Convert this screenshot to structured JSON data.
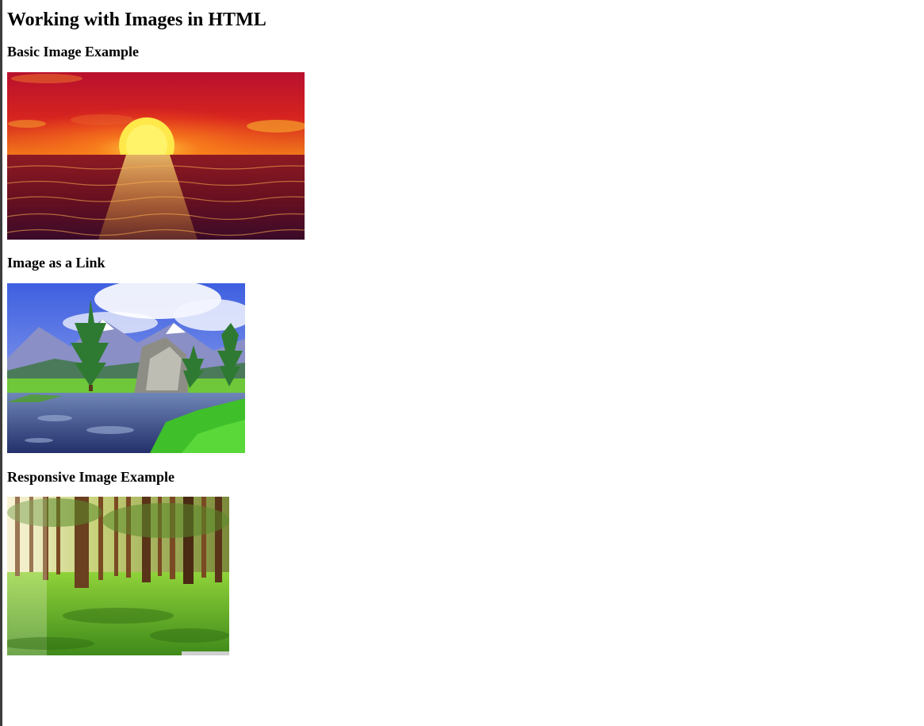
{
  "page": {
    "title": "Working with Images in HTML"
  },
  "sections": [
    {
      "heading": "Basic Image Example",
      "image": "sunset-over-sea-image"
    },
    {
      "heading": "Image as a Link",
      "image": "mountain-lake-landscape-image"
    },
    {
      "heading": "Responsive Image Example",
      "image": "forest-with-sunlight-image"
    }
  ],
  "colors": {
    "left_edge": "#3c3c3c",
    "text": "#000000"
  }
}
